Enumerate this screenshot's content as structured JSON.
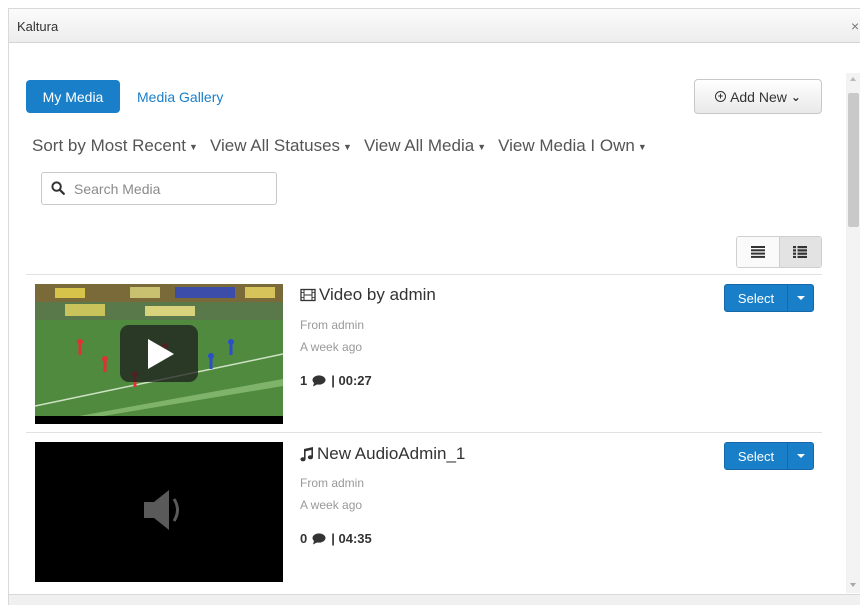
{
  "window": {
    "title": "Kaltura",
    "close_label": "×"
  },
  "tabs": {
    "active": "My Media",
    "other": "Media Gallery"
  },
  "add_new": {
    "label": "Add New"
  },
  "filters": [
    "Sort by Most Recent",
    "View All Statuses",
    "View All Media",
    "View Media I Own"
  ],
  "search": {
    "placeholder": "Search Media",
    "value": ""
  },
  "colors": {
    "accent": "#1a7fc9"
  },
  "media": [
    {
      "type_icon": "film-icon",
      "title": "Video by admin",
      "from": "From admin",
      "when": "A week ago",
      "comments": "1",
      "duration": "| 00:27",
      "select_label": "Select"
    },
    {
      "type_icon": "music-note-icon",
      "title": "New AudioAdmin_1",
      "from": "From admin",
      "when": "A week ago",
      "comments": "0",
      "duration": "| 04:35",
      "select_label": "Select"
    }
  ]
}
